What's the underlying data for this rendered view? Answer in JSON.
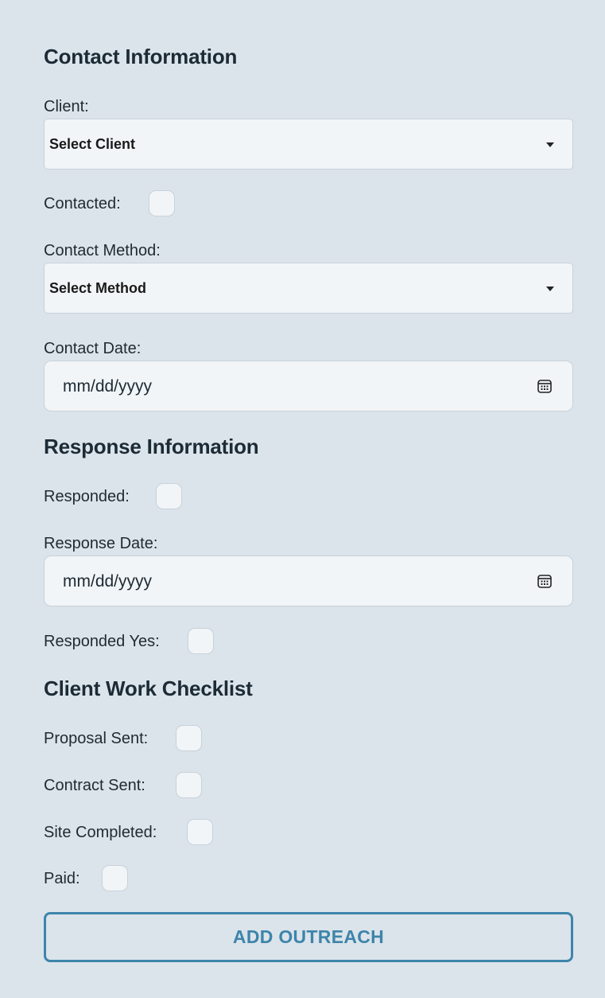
{
  "contact_section": {
    "title": "Contact Information",
    "client_label": "Client:",
    "client_select_value": "Select Client",
    "contacted_label": "Contacted:",
    "contact_method_label": "Contact Method:",
    "contact_method_select_value": "Select Method",
    "contact_date_label": "Contact Date:",
    "contact_date_placeholder": "mm/dd/yyyy"
  },
  "response_section": {
    "title": "Response Information",
    "responded_label": "Responded:",
    "response_date_label": "Response Date:",
    "response_date_placeholder": "mm/dd/yyyy",
    "responded_yes_label": "Responded Yes:"
  },
  "checklist_section": {
    "title": "Client Work Checklist",
    "proposal_sent_label": "Proposal Sent:",
    "contract_sent_label": "Contract Sent:",
    "site_completed_label": "Site Completed:",
    "paid_label": "Paid:"
  },
  "submit_label": "ADD OUTREACH",
  "colors": {
    "background": "#dbe4ea",
    "input_background": "#f1f5f8",
    "accent": "#3e84ab"
  },
  "icons": {
    "select_caret": "chevron-down-icon",
    "date_picker": "calendar-icon"
  }
}
